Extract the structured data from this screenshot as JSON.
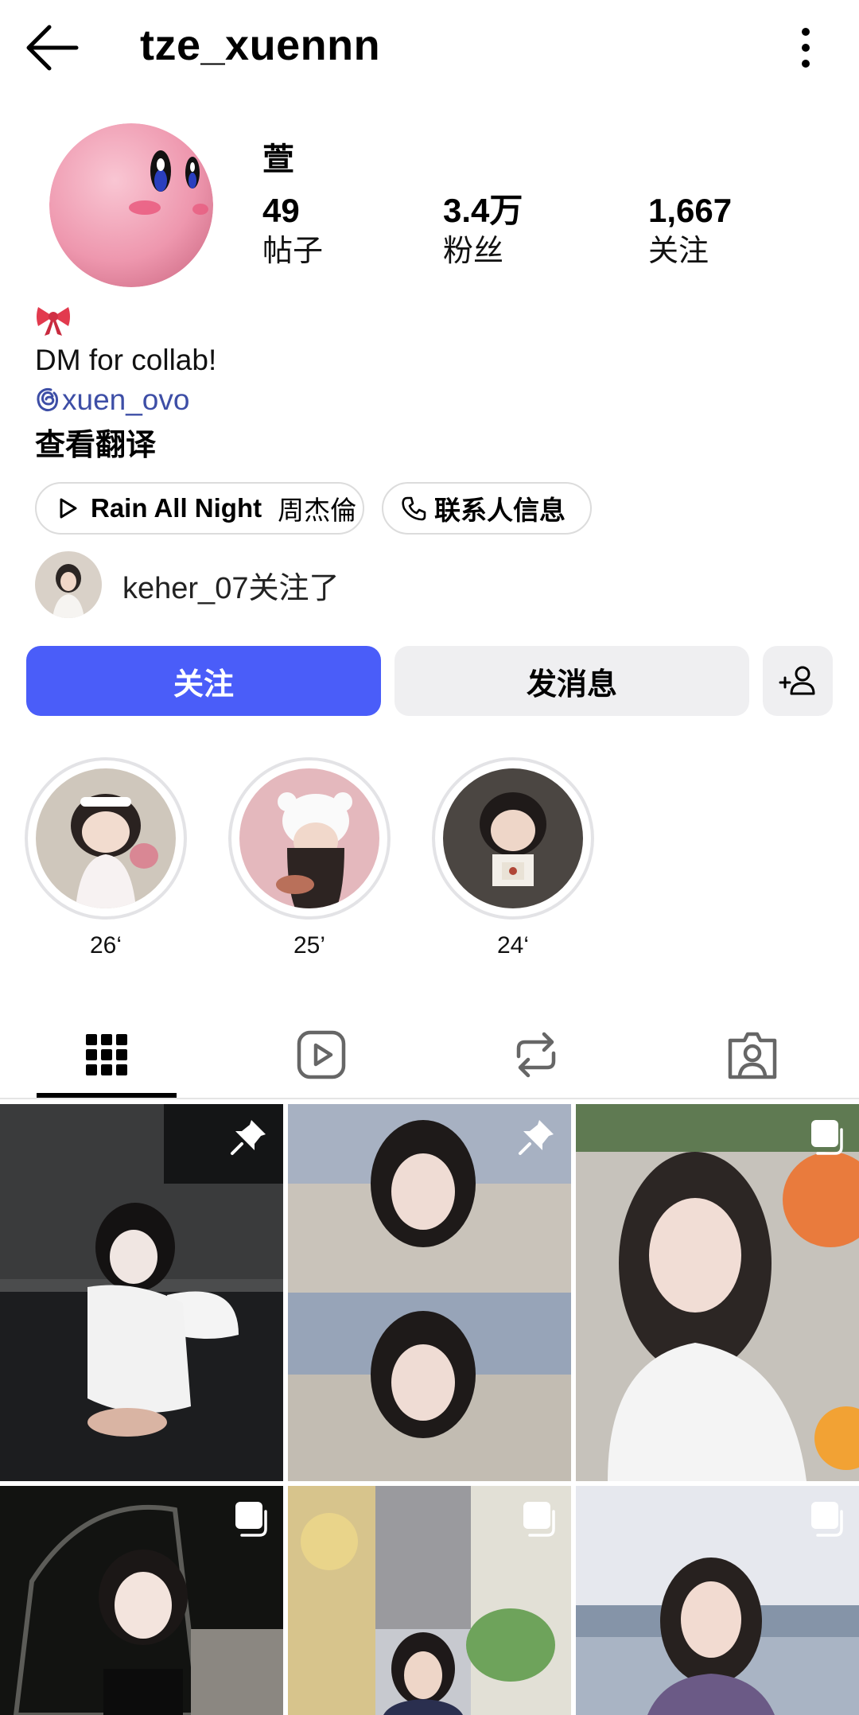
{
  "header": {
    "username": "tze_xuennn"
  },
  "profile": {
    "display_name": "萱",
    "stats": [
      {
        "value": "49",
        "label": "帖子"
      },
      {
        "value": "3.4万",
        "label": "粉丝"
      },
      {
        "value": "1,667",
        "label": "关注"
      }
    ],
    "bio_line": "DM for collab!",
    "threads_handle": "xuen_ovo",
    "translate_label": "查看翻译",
    "music_chip": {
      "song": "Rain All Night",
      "artist": "周杰倫"
    },
    "contact_chip": "联系人信息",
    "followed_by_text": "keher_07关注了"
  },
  "actions": {
    "follow_label": "关注",
    "message_label": "发消息"
  },
  "highlights": [
    {
      "label": "26‘"
    },
    {
      "label": "25’"
    },
    {
      "label": "24‘"
    }
  ],
  "colors": {
    "accent": "#4a5df9",
    "link": "#3d4ea6",
    "secondary_button": "#efeff1"
  },
  "icons": {
    "tabs": [
      "grid-icon",
      "reels-icon",
      "reposts-icon",
      "tagged-icon"
    ]
  }
}
